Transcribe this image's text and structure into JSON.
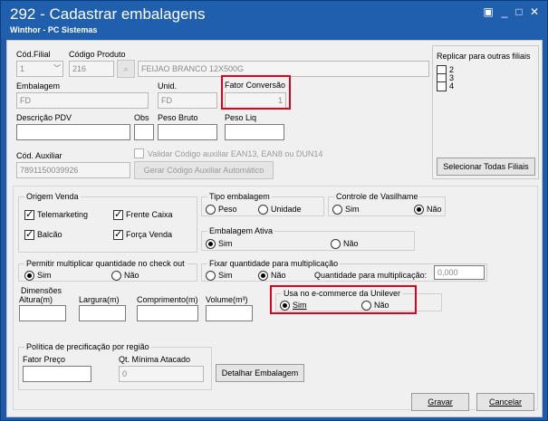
{
  "window": {
    "title": "292 - Cadastrar embalagens",
    "subtitle": "Winthor - PC Sistemas",
    "controls": {
      "restore": "▣",
      "minimize": "_",
      "maximize": "□",
      "close": "✕"
    }
  },
  "form": {
    "cod_filial": {
      "label": "Cód.Filial",
      "value": "1"
    },
    "cod_produto": {
      "label": "Código Produto",
      "value": "216",
      "description": "FEIJAO BRANCO 12X500G"
    },
    "embalagem": {
      "label": "Embalagem",
      "value": "FD"
    },
    "unid": {
      "label": "Unid.",
      "value": "FD"
    },
    "fator_conversao": {
      "label": "Fator Conversão",
      "value": "1"
    },
    "descricao_pdv": {
      "label": "Descrição PDV",
      "value": ""
    },
    "obs": {
      "label": "Obs",
      "value": ""
    },
    "peso_bruto": {
      "label": "Peso Bruto",
      "value": ""
    },
    "peso_liq": {
      "label": "Peso Liq",
      "value": ""
    },
    "cod_auxiliar": {
      "label": "Cód. Auxiliar",
      "value": "7891150039926"
    },
    "validar_label": "Validar Código auxiliar EAN13, EAN8 ou DUN14",
    "gerar_button": "Gerar Código Auxiliar Automático"
  },
  "replicar": {
    "label": "Replicar para outras filiais",
    "filiais": [
      "2",
      "3",
      "4"
    ],
    "select_all_button": "Selecionar Todas Filiais"
  },
  "origem_venda": {
    "label": "Origem Venda",
    "telemarketing": "Telemarketing",
    "frente_caixa": "Frente Caixa",
    "balcao": "Balcão",
    "forca_venda": "Força Venda"
  },
  "tipo_embalagem": {
    "label": "Tipo embalagem",
    "peso": "Peso",
    "unidade": "Unidade"
  },
  "controle_vasilhame": {
    "label": "Controle de Vasilhame",
    "sim": "Sim",
    "nao": "Não"
  },
  "embalagem_ativa": {
    "label": "Embalagem Ativa",
    "sim": "Sim",
    "nao": "Não"
  },
  "permitir_multiplicar": {
    "label": "Permitir multiplicar quantidade no check out",
    "sim": "Sim",
    "nao": "Não"
  },
  "fixar_quantidade": {
    "label": "Fixar quantidade para multiplicação",
    "sim": "Sim",
    "nao": "Não",
    "qtd_label": "Quantidade para multiplicação:",
    "qtd_value": "0,000"
  },
  "dimensoes": {
    "label": "Dimensões",
    "altura": "Altura(m)",
    "largura": "Largura(m)",
    "comprimento": "Comprimento(m)",
    "volume": "Volume(m³)"
  },
  "ecommerce": {
    "label": "Usa no e-commerce da Unilever",
    "sim": "Sim",
    "nao": "Não"
  },
  "politica": {
    "label": "Política de precificação por região",
    "fator_preco": "Fator Preço",
    "qt_minima": "Qt. Mínima Atacado",
    "qt_minima_value": "0"
  },
  "buttons": {
    "detalhar": "Detalhar Embalagem",
    "gravar": "Gravar",
    "cancelar": "Cancelar"
  },
  "colors": {
    "titlebar": "#1f5fae",
    "highlight": "#e0001b"
  }
}
